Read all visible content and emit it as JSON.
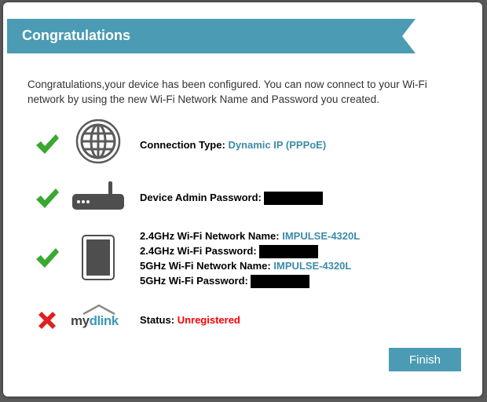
{
  "dialog": {
    "title": "Congratulations",
    "intro": "Congratulations,your device has been configured. You can now connect to your Wi-Fi network by using the new Wi-Fi Network Name and Password you created."
  },
  "connection": {
    "label": "Connection Type:",
    "value": "Dynamic IP (PPPoE)",
    "status_icon": "checkmark-icon"
  },
  "admin": {
    "label": "Device Admin Password:",
    "value_redacted": true,
    "status_icon": "checkmark-icon"
  },
  "wifi": {
    "ssid24_label": "2.4GHz Wi-Fi Network Name:",
    "ssid24_value": "IMPULSE-4320L",
    "pass24_label": "2.4GHz Wi-Fi Password:",
    "ssid5_label": "5GHz Wi-Fi Network Name:",
    "ssid5_value": "IMPULSE-4320L",
    "pass5_label": "5GHz Wi-Fi Password:",
    "status_icon": "checkmark-icon"
  },
  "mydlink": {
    "logo_text_my": "my",
    "logo_text_dlink": "dlink",
    "status_label": "Status:",
    "status_value": "Unregistered",
    "status_icon": "x-icon"
  },
  "buttons": {
    "finish": "Finish"
  },
  "colors": {
    "banner": "#4a9bb3",
    "link_value": "#3d8ba8",
    "error": "#ff0000",
    "check": "#3aa832",
    "cross": "#e02020"
  }
}
